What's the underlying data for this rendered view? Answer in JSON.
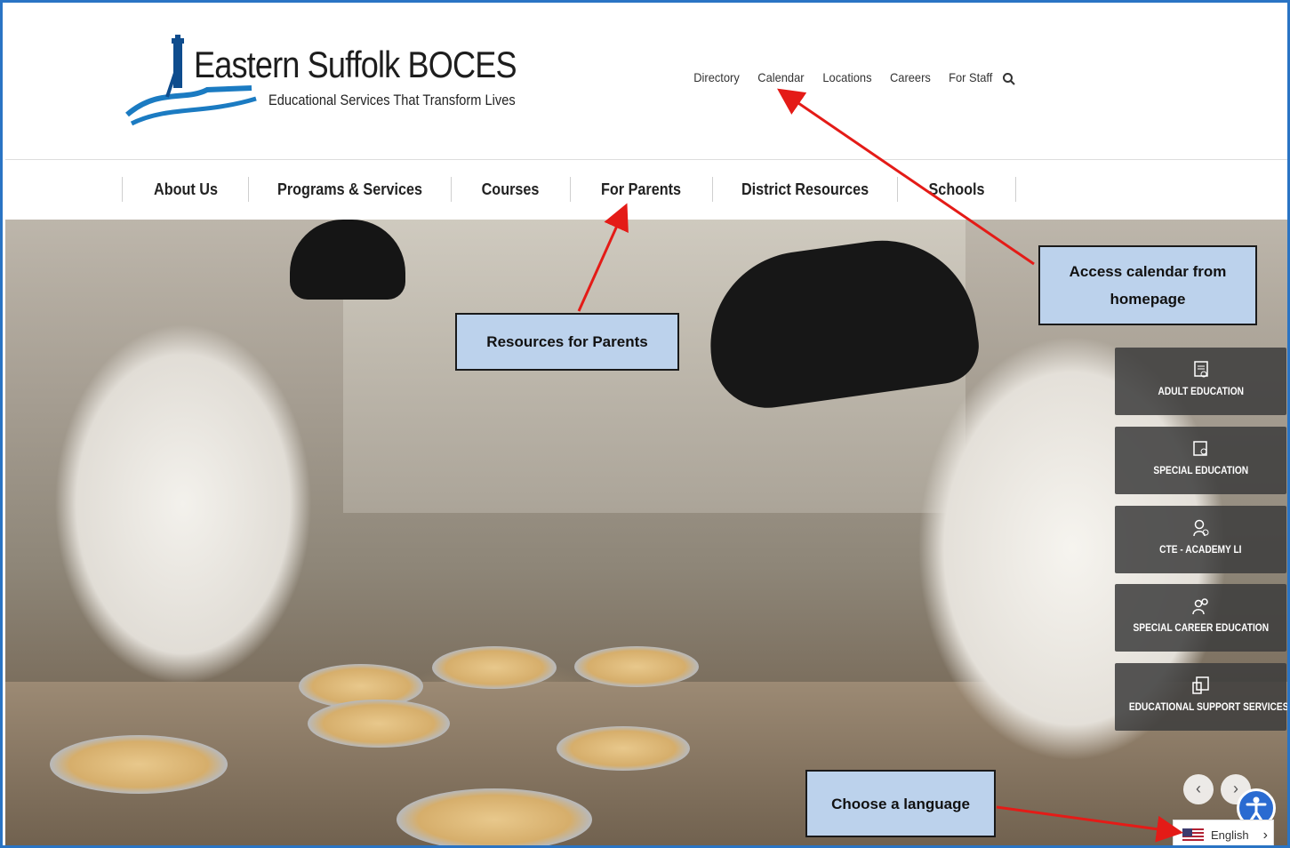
{
  "header": {
    "logo_title": "Eastern Suffolk BOCES",
    "logo_tagline": "Educational Services That Transform Lives",
    "utility_links": [
      "Directory",
      "Calendar",
      "Locations",
      "Careers",
      "For Staff"
    ]
  },
  "nav": {
    "items": [
      "About Us",
      "Programs & Services",
      "Courses",
      "For Parents",
      "District Resources",
      "Schools"
    ]
  },
  "quick_links": [
    "ADULT EDUCATION",
    "SPECIAL EDUCATION",
    "CTE - ACADEMY LI",
    "SPECIAL CAREER EDUCATION",
    "EDUCATIONAL SUPPORT SERVICES"
  ],
  "carousel": {
    "prev": "‹",
    "next": "›"
  },
  "language": {
    "label": "English",
    "chevron": "›"
  },
  "annotations": {
    "calendar": "Access calendar from homepage",
    "parents": "Resources for Parents",
    "language": "Choose a language"
  },
  "colors": {
    "frame": "#2a74c4",
    "callout": "#bcd2ec",
    "arrow": "#e41b17",
    "accent_blue": "#2a6bd1"
  }
}
